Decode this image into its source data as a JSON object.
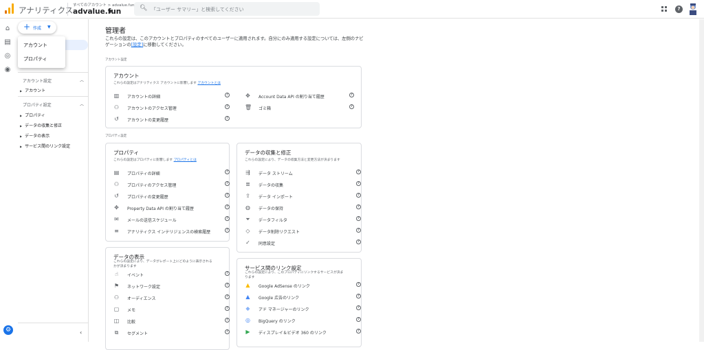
{
  "header": {
    "app_title": "アナリティクス",
    "breadcrumb": "すべてのアカウント > advalue.fun",
    "account_name": "advalue.fun",
    "search_placeholder": "「ユーザー サマリー」と検索してください"
  },
  "colors": {
    "accent": "#1a73e8",
    "logo_orange": "#f9ab00",
    "logo_dark": "#e37400"
  },
  "create_button": {
    "label": "作成"
  },
  "create_menu": {
    "items": [
      "アカウント",
      "プロパティ"
    ]
  },
  "sidenav": {
    "account_section": "アカウント設定",
    "account_items": [
      "アカウント"
    ],
    "property_section": "プロパティ設定",
    "property_items": [
      "プロパティ",
      "データの収集と修正",
      "データの表示",
      "サービス間のリンク設定"
    ]
  },
  "main": {
    "title": "管理者",
    "desc_before": "これらの設定は、このアカウントとプロパティのすべてのユーザーに適用されます。自分にのみ適用する設定については、左側のナビゲーションの",
    "desc_link": "[設定]",
    "desc_after": "に移動してください。",
    "account_settings_label": "アカウント設定",
    "property_settings_label": "プロパティ設定"
  },
  "account_card": {
    "title": "アカウント",
    "desc": "これらの設定はアナリティクス アカウントに影響します",
    "desc_link": "アカウントとは",
    "left": [
      {
        "icon": "building-icon",
        "label": "アカウントの詳細"
      },
      {
        "icon": "people-icon",
        "label": "アカウントのアクセス管理"
      },
      {
        "icon": "history-icon",
        "label": "アカウントの変更履歴"
      }
    ],
    "right": [
      {
        "icon": "api-icon",
        "label": "Account Data API の割り当て履歴"
      },
      {
        "icon": "trash-icon",
        "label": "ゴミ箱"
      }
    ]
  },
  "property_card": {
    "title": "プロパティ",
    "desc": "これらの設定はプロパティに影響します",
    "desc_link": "プロパティとは",
    "items": [
      {
        "icon": "table-icon",
        "label": "プロパティの詳細"
      },
      {
        "icon": "people-icon",
        "label": "プロパティのアクセス管理"
      },
      {
        "icon": "history-icon",
        "label": "プロパティの変更履歴"
      },
      {
        "icon": "api-icon",
        "label": "Property Data API の割り当て履歴"
      },
      {
        "icon": "email-schedule-icon",
        "label": "メールの送信スケジュール"
      },
      {
        "icon": "search-history-icon",
        "label": "アナリティクス インテリジェンスの検索履歴"
      }
    ]
  },
  "data_collection_card": {
    "title": "データの収集と修正",
    "desc": "これらの設定により、データの収集方法と変更方法が決まります",
    "items": [
      {
        "icon": "stream-icon",
        "label": "データ ストリーム"
      },
      {
        "icon": "database-icon",
        "label": "データの収集"
      },
      {
        "icon": "upload-icon",
        "label": "データ インポート"
      },
      {
        "icon": "retention-icon",
        "label": "データの保持"
      },
      {
        "icon": "filter-icon",
        "label": "データフィルタ"
      },
      {
        "icon": "eraser-icon",
        "label": "データ削除リクエスト"
      },
      {
        "icon": "consent-icon",
        "label": "同意設定"
      }
    ]
  },
  "data_display_card": {
    "title": "データの表示",
    "desc1": "これらの設定により、データがレポート上にどのように表示される",
    "desc2": "かが決まります",
    "items": [
      {
        "icon": "touch-icon",
        "label": "イベント"
      },
      {
        "icon": "flag-icon",
        "label": "ネットワーク設定"
      },
      {
        "icon": "audience-icon",
        "label": "オーディエンス"
      },
      {
        "icon": "note-icon",
        "label": "メモ"
      },
      {
        "icon": "compare-icon",
        "label": "比較"
      },
      {
        "icon": "segment-icon",
        "label": "セグメント"
      }
    ]
  },
  "links_card": {
    "title": "サービス間のリンク設定",
    "desc1": "これらの設定により、このプロパティにリンクするサービスが決ま",
    "desc2": "ります",
    "items": [
      {
        "icon": "adsense-icon",
        "label": "Google AdSense のリンク"
      },
      {
        "icon": "google-ads-icon",
        "label": "Google 広告のリンク"
      },
      {
        "icon": "tag-manager-icon",
        "label": "アド マネージャーのリンク"
      },
      {
        "icon": "bigquery-icon",
        "label": "BigQuery のリンク"
      },
      {
        "icon": "dv360-icon",
        "label": "ディスプレイ＆ビデオ 360 のリンク"
      }
    ]
  }
}
